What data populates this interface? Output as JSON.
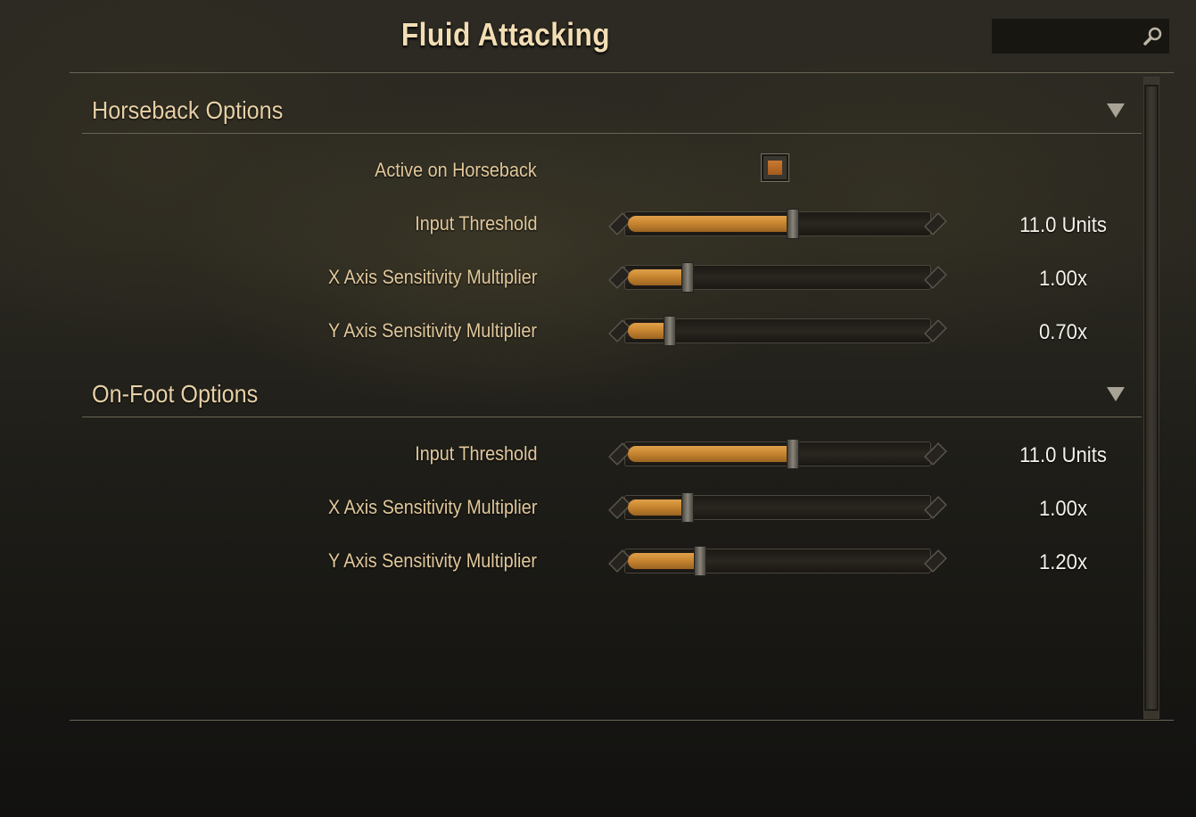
{
  "title": "Fluid Attacking",
  "search": {
    "value": "",
    "placeholder": ""
  },
  "sections": [
    {
      "title": "Horseback Options",
      "rows": [
        {
          "label": "Active on Horseback",
          "type": "checkbox",
          "checked": true
        },
        {
          "label": "Input Threshold",
          "type": "slider",
          "value_text": "11.0 Units",
          "fill": 0.55
        },
        {
          "label": "X Axis Sensitivity Multiplier",
          "type": "slider",
          "value_text": "1.00x",
          "fill": 0.2
        },
        {
          "label": "Y Axis Sensitivity Multiplier",
          "type": "slider",
          "value_text": "0.70x",
          "fill": 0.14
        }
      ]
    },
    {
      "title": "On-Foot Options",
      "rows": [
        {
          "label": "Input Threshold",
          "type": "slider",
          "value_text": "11.0 Units",
          "fill": 0.55
        },
        {
          "label": "X Axis Sensitivity Multiplier",
          "type": "slider",
          "value_text": "1.00x",
          "fill": 0.2
        },
        {
          "label": "Y Axis Sensitivity Multiplier",
          "type": "slider",
          "value_text": "1.20x",
          "fill": 0.24
        }
      ]
    }
  ],
  "colors": {
    "accent": "#c88630",
    "label": "#e1c89b",
    "title": "#f2ddb4"
  },
  "icons": {
    "search": "search-icon",
    "collapse": "chevron-down-icon"
  }
}
